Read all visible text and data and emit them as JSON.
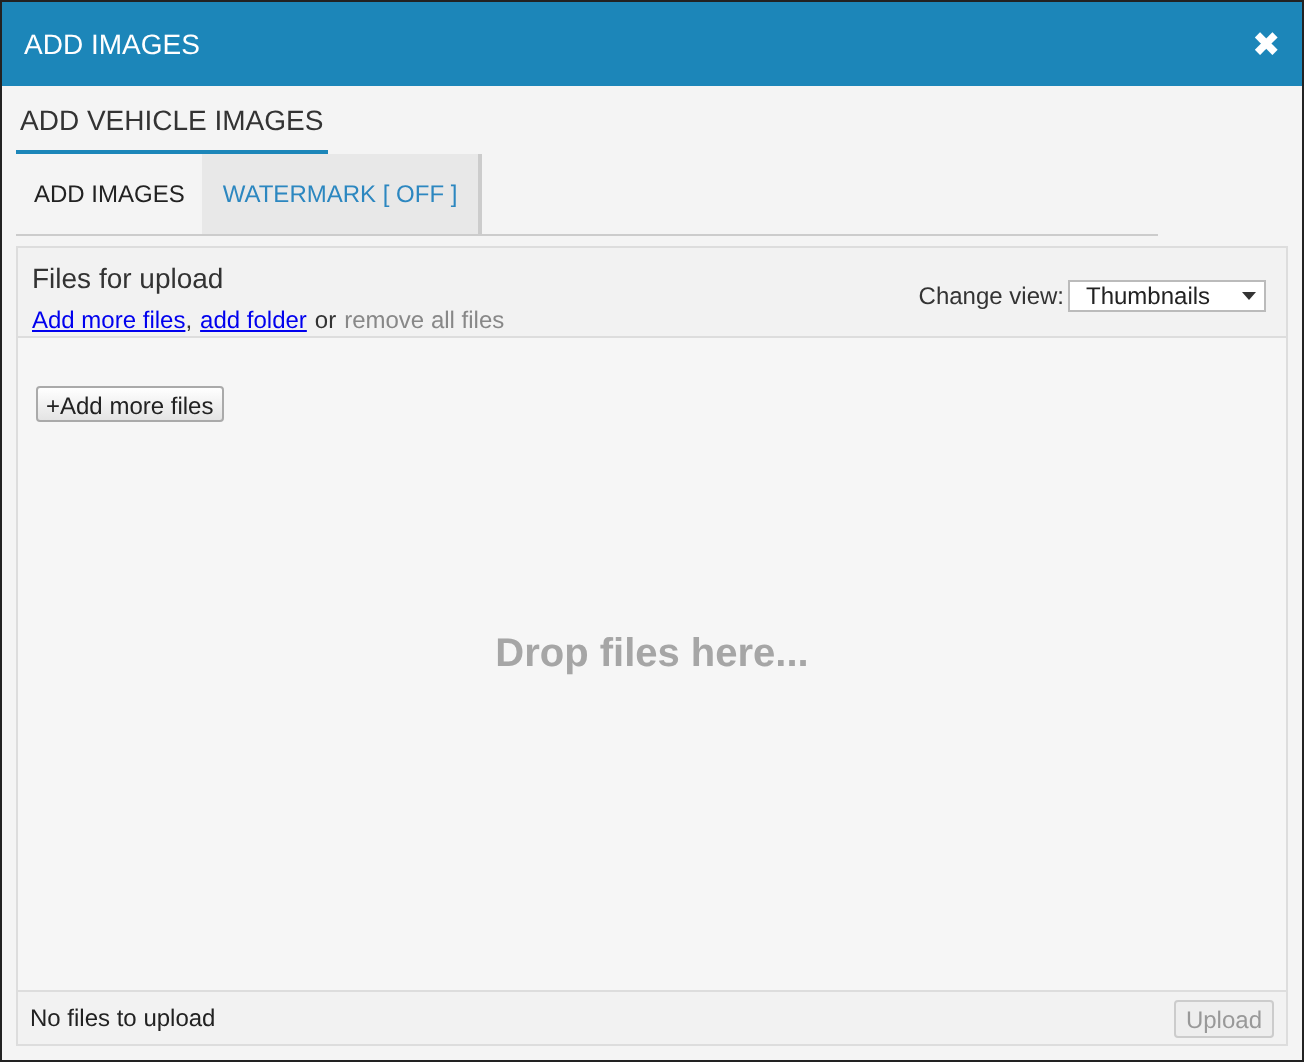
{
  "window": {
    "title": "ADD IMAGES",
    "close": "✖"
  },
  "section_title": "ADD VEHICLE IMAGES",
  "tabs": [
    {
      "label": "ADD IMAGES",
      "selected": true
    },
    {
      "label": "WATERMARK [ OFF ]",
      "selected": false
    }
  ],
  "uploader": {
    "title": "Files for upload",
    "actions": [
      {
        "kind": "link",
        "text": "Add more files"
      },
      {
        "kind": "text",
        "text": ","
      },
      {
        "kind": "link",
        "text": "add folder"
      },
      {
        "kind": "text",
        "text": "or"
      },
      {
        "kind": "inactive",
        "text": "remove all files"
      }
    ],
    "view_label": "Change view:",
    "view_value": "Thumbnails",
    "add_button": "+Add more files",
    "drop_hint": "Drop files here...",
    "status": "No files to upload",
    "upload_button": {
      "label": "Upload",
      "disabled": true
    }
  }
}
